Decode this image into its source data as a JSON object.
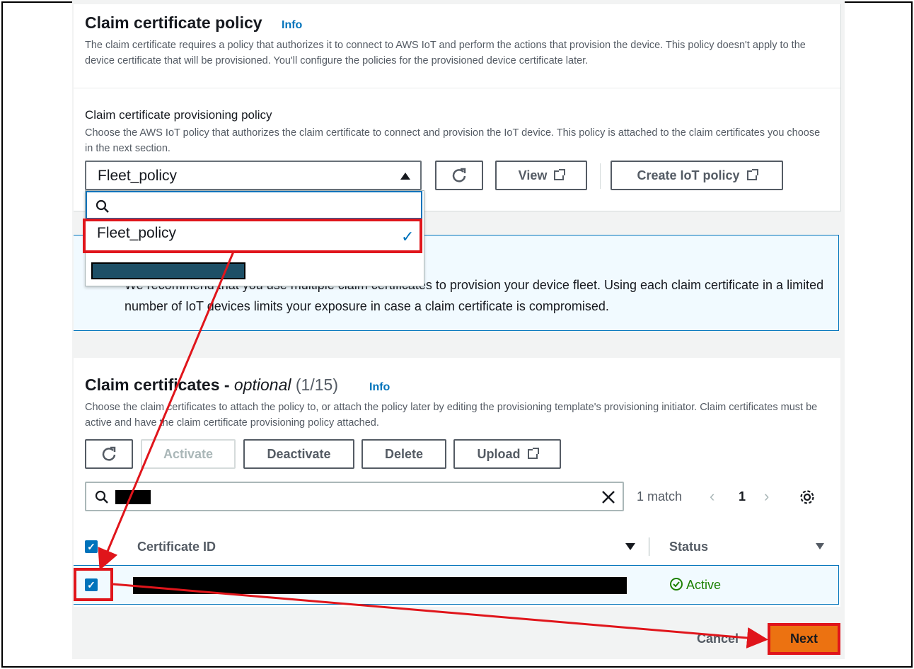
{
  "policy_section": {
    "title": "Claim certificate policy",
    "info": "Info",
    "description": "The claim certificate requires a policy that authorizes it to connect to AWS IoT and perform the actions that provision the device. This policy doesn't apply to the device certificate that will be provisioned. You'll configure the policies for the provisioned device certificate later.",
    "field_label": "Claim certificate provisioning policy",
    "field_description": "Choose the AWS IoT policy that authorizes the claim certificate to connect and provision the IoT device. This policy is attached to the claim certificates you choose in the next section.",
    "selected_value": "Fleet_policy",
    "view_label": "View",
    "create_label": "Create IoT policy",
    "dropdown_option": "Fleet_policy"
  },
  "alert": {
    "text": "We recommend that you use multiple claim certificates to provision your device fleet. Using each claim certificate in a limited number of IoT devices limits your exposure in case a claim certificate is compromised."
  },
  "certificates_section": {
    "title": "Claim certificates -",
    "optional": "optional",
    "count": "(1/15)",
    "info": "Info",
    "description": "Choose the claim certificates to attach the policy to, or attach the policy later by editing the provisioning template's provisioning initiator. Claim certificates must be active and have the claim certificate provisioning policy attached.",
    "activate_label": "Activate",
    "deactivate_label": "Deactivate",
    "delete_label": "Delete",
    "upload_label": "Upload",
    "match_text": "1 match",
    "page_number": "1",
    "col_certificate_id": "Certificate ID",
    "col_status": "Status",
    "row_status": "Active"
  },
  "footer": {
    "cancel_label": "Cancel",
    "next_label": "Next"
  },
  "colors": {
    "accent": "#0073bb",
    "primary_button": "#ec7211",
    "highlight": "#e0151b",
    "success": "#1d8102"
  }
}
